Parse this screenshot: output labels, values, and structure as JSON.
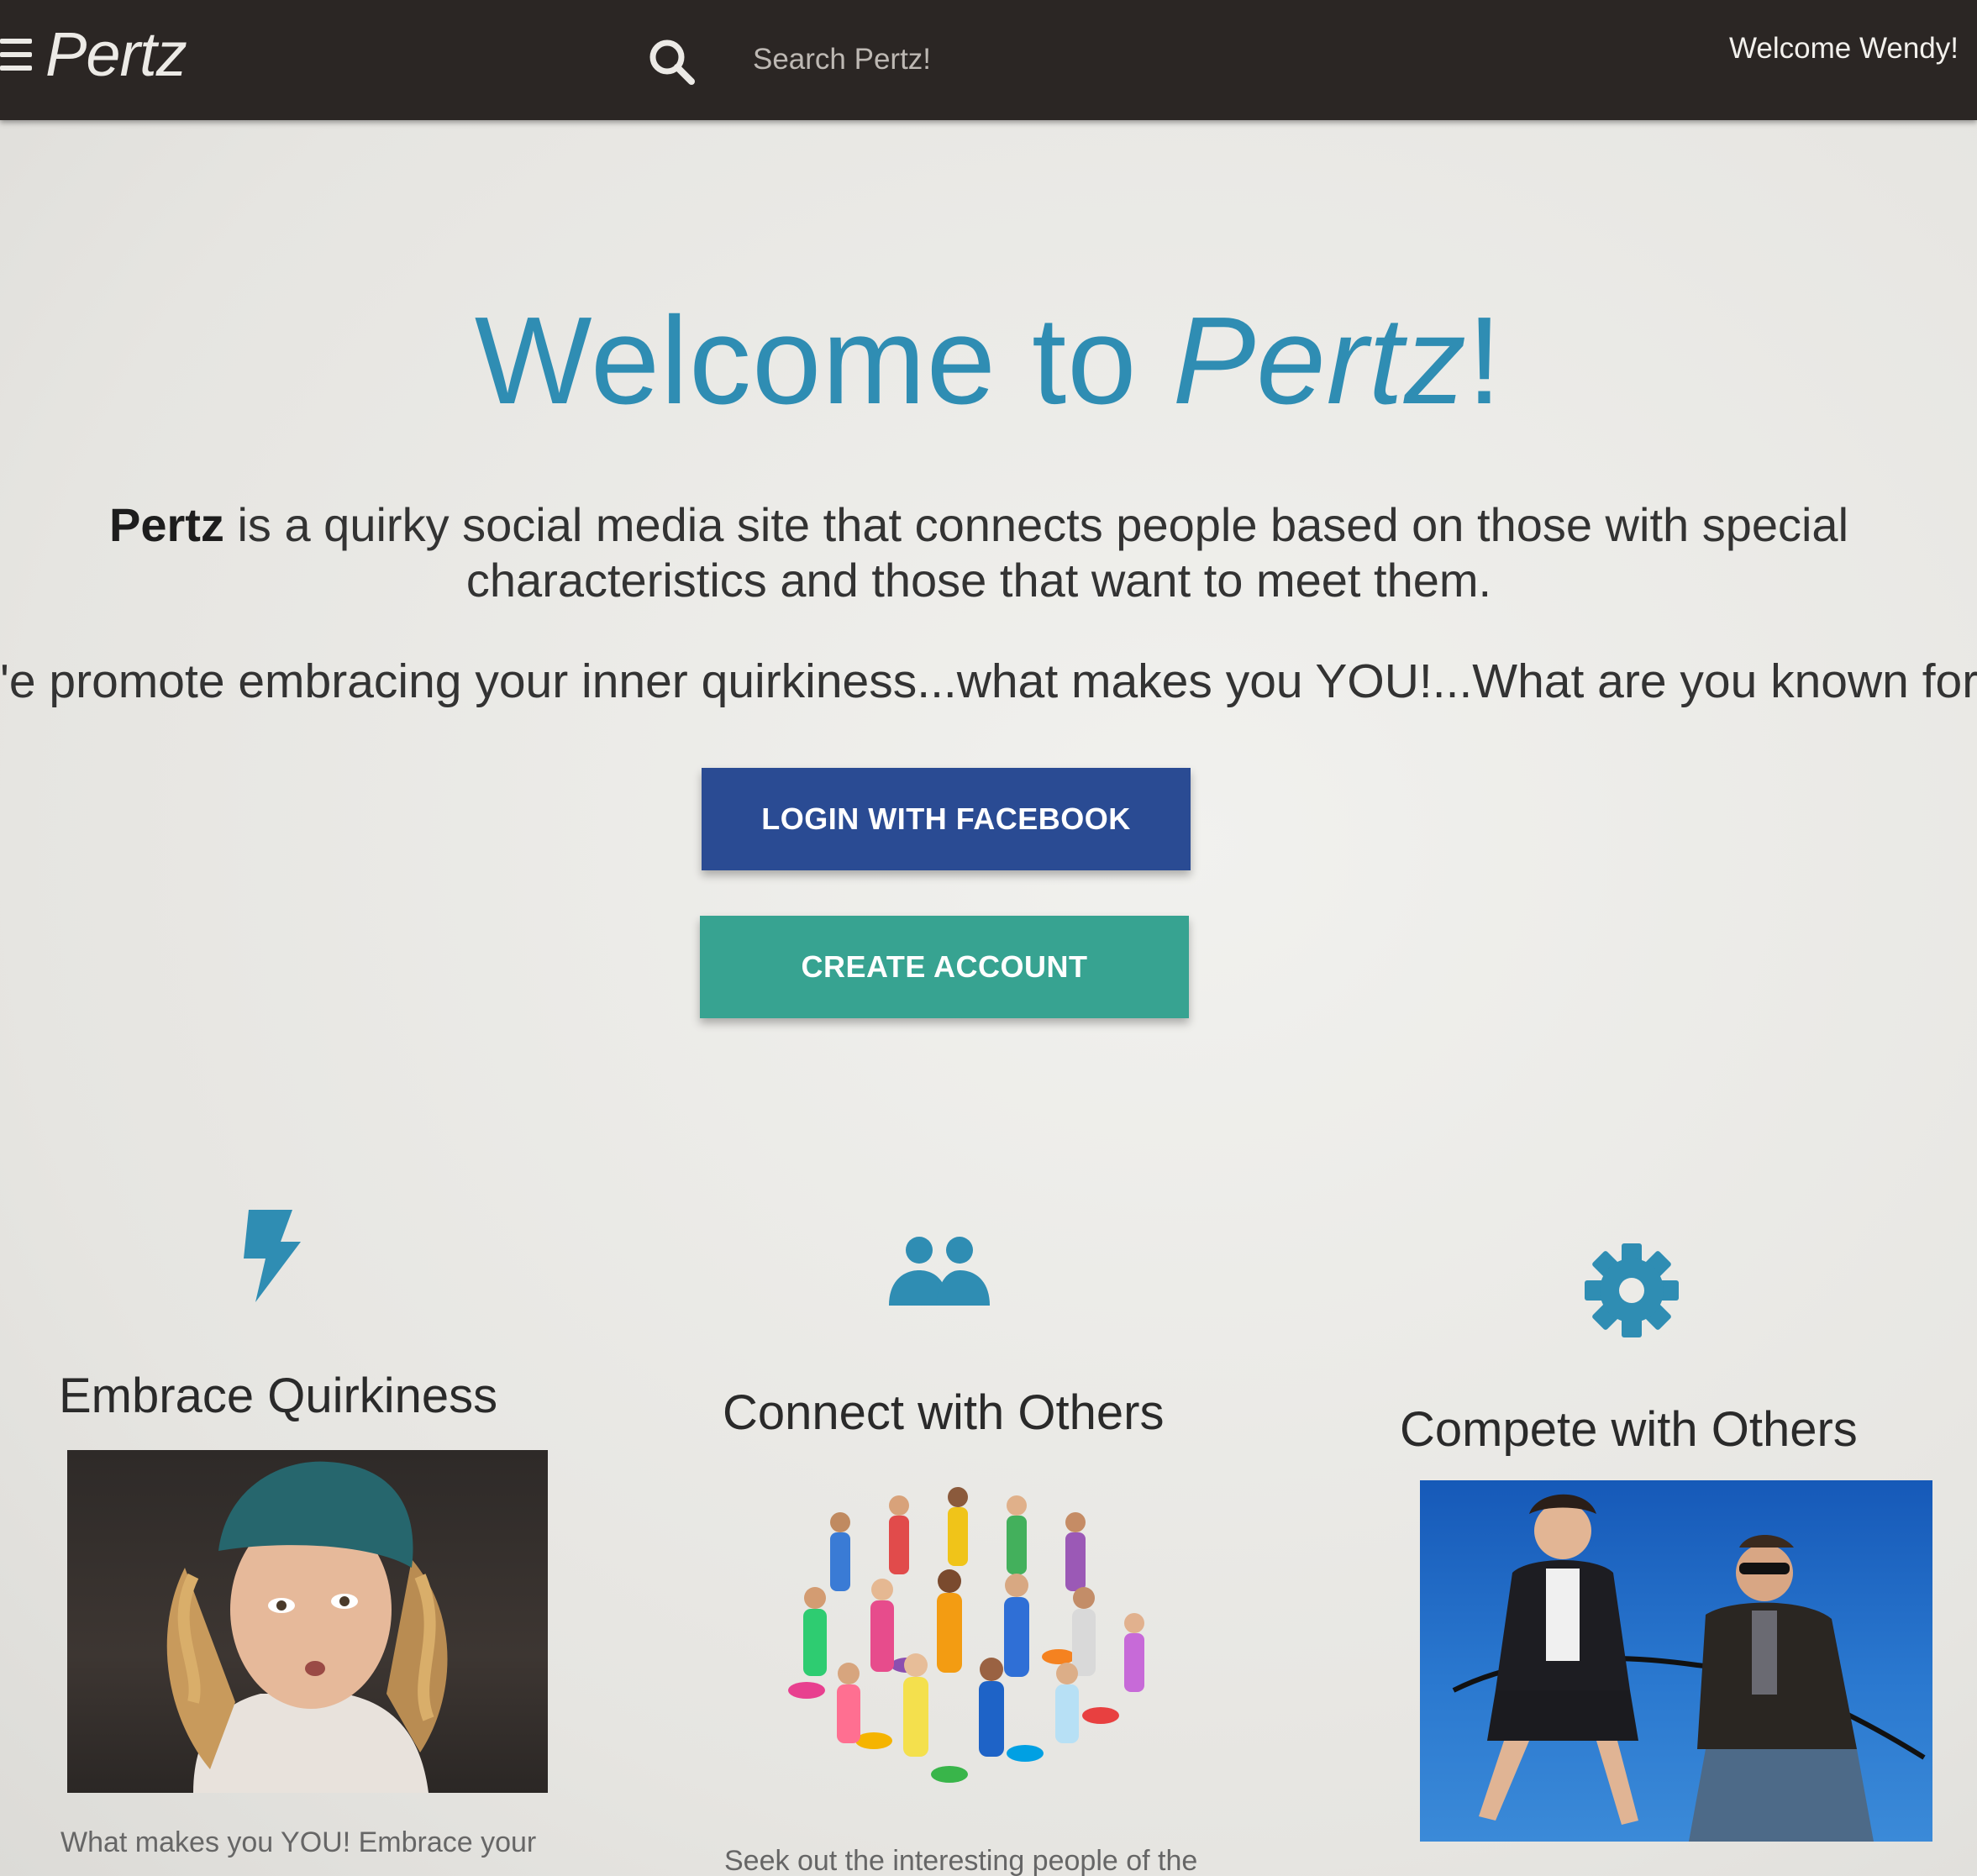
{
  "navbar": {
    "brand": "Pertz",
    "search_placeholder": "Search Pertz!",
    "welcome_user": "Welcome Wendy!"
  },
  "hero": {
    "title_prefix": "Welcome to ",
    "title_brand": "Pertz",
    "title_suffix": "!",
    "tagline_brand": "Pertz",
    "tagline_rest": " is a quirky social media site that connects people based on those with special characteristics and those that want to meet them.",
    "promote_text": "'e promote embracing your inner quirkiness...what makes you YOU!...What are you known for?"
  },
  "buttons": {
    "facebook_label": "LOGIN WITH FACEBOOK",
    "create_label": "CREATE ACCOUNT"
  },
  "features": [
    {
      "icon": "lightning-bolt-icon",
      "title": "Embrace Quirkiness",
      "description": "What makes you YOU! Embrace your"
    },
    {
      "icon": "people-icon",
      "title": "Connect with Others",
      "description": "Seek out the interesting people of the"
    },
    {
      "icon": "gear-icon",
      "title": "Compete with Others",
      "description": ""
    }
  ],
  "colors": {
    "navbar": "#2b2624",
    "accent": "#2f8db3",
    "facebook_button": "#2a4b93",
    "create_button": "#37a391"
  }
}
